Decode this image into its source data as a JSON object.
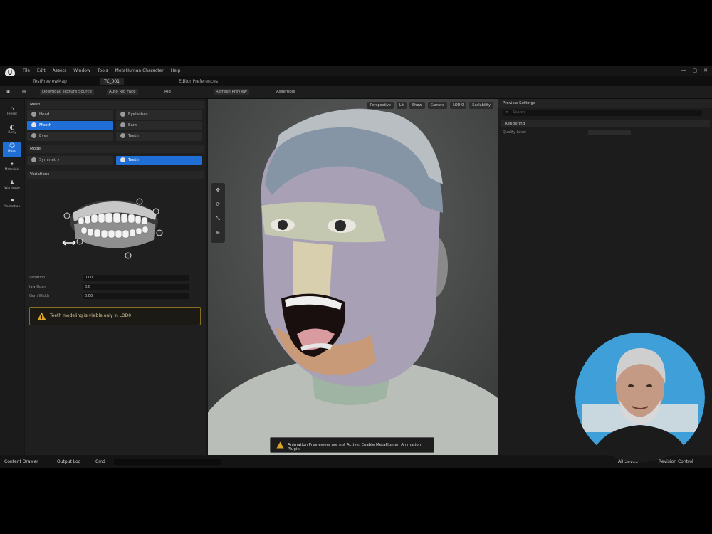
{
  "app": {
    "logo": "U",
    "menu": [
      "File",
      "Edit",
      "Assets",
      "Window",
      "Tools",
      "MetaHuman Character",
      "Help"
    ],
    "window_controls": [
      "—",
      "▢",
      "✕"
    ]
  },
  "tabs": [
    {
      "label": "TestPreviewMap",
      "active": false
    },
    {
      "label": "TC_001",
      "active": true
    },
    {
      "label": "Editor Preferences",
      "active": false
    }
  ],
  "toolbar": {
    "items": [
      "Download Texture Source",
      "Auto Rig Face",
      "Rig",
      "Refresh Preview",
      "Assemble"
    ]
  },
  "rail": [
    {
      "icon": "⌂",
      "label": "Preset"
    },
    {
      "icon": "◐",
      "label": "Body"
    },
    {
      "icon": "☺",
      "label": "Head",
      "active": true
    },
    {
      "icon": "✦",
      "label": "Materials"
    },
    {
      "icon": "♟",
      "label": "Wardrobe"
    },
    {
      "icon": "⚑",
      "label": "Animation"
    }
  ],
  "left_panel": {
    "section1_title": "Mesh",
    "options1": [
      {
        "label": "Head",
        "selected": false
      },
      {
        "label": "Eyelashes",
        "selected": false
      },
      {
        "label": "Mouth",
        "selected": true
      },
      {
        "label": "Ears",
        "selected": false
      },
      {
        "label": "Eyes",
        "selected": false
      },
      {
        "label": "Teeth",
        "selected": false
      }
    ],
    "section2_title": "Model",
    "options2": [
      {
        "label": "Symmetry",
        "selected": false
      },
      {
        "label": "Teeth",
        "selected": true
      }
    ],
    "section3_title": "Variations",
    "props": [
      {
        "label": "Variation",
        "value": "0.00"
      },
      {
        "label": "Jaw Open",
        "value": "0.0"
      },
      {
        "label": "Gum Width",
        "value": "0.00"
      }
    ],
    "warning": "Teeth modeling is visible only in LOD0"
  },
  "viewport": {
    "buttons": [
      "Perspective",
      "Lit",
      "Show",
      "Camera",
      "LOD 0",
      "Scalability"
    ],
    "tools": [
      "✥",
      "⟳",
      "⤡",
      "⊕"
    ]
  },
  "right_panel": {
    "title": "Preview Settings",
    "search_placeholder": "Search",
    "section": "Rendering",
    "row_label": "Quality Level"
  },
  "bottom": {
    "left": [
      "Content Drawer",
      "Output Log",
      "Cmd"
    ],
    "right": [
      "All Saved",
      "Revision Control"
    ]
  },
  "notification": "Animation Previewers are not Active: Enable MetaHuman Animation Plugin",
  "colors": {
    "accent": "#1f6fd6",
    "warning": "#d9a62b"
  }
}
